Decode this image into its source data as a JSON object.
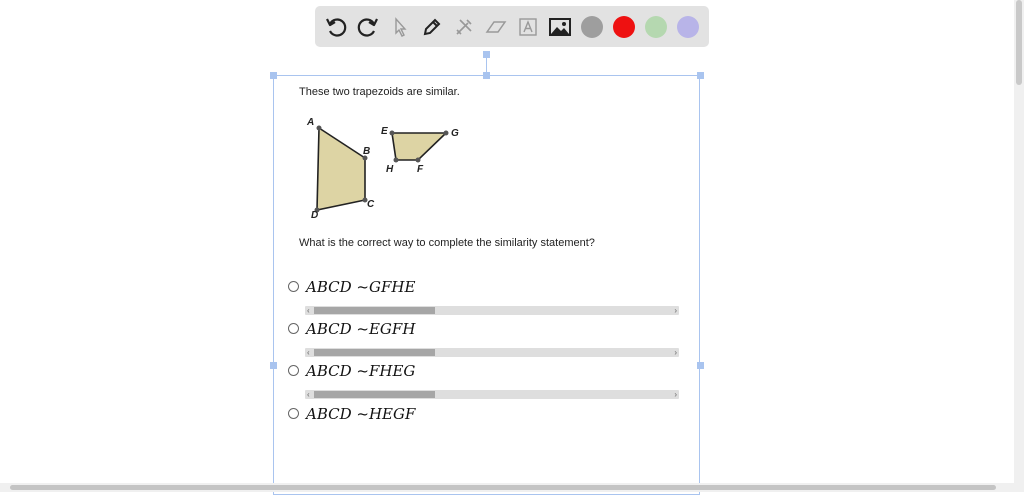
{
  "toolbar": {
    "tools": [
      "undo-icon",
      "redo-icon",
      "pointer-icon",
      "pen-icon",
      "tools-icon",
      "eraser-icon",
      "text-box-icon",
      "image-icon"
    ],
    "colors": [
      "#9e9e9e",
      "#ee1111",
      "#b5d8b0",
      "#b8b4e8"
    ]
  },
  "question": {
    "intro": "These two trapezoids are similar.",
    "prompt": "What is the correct way to complete the similarity statement?"
  },
  "figure": {
    "labels": {
      "A": "A",
      "B": "B",
      "C": "C",
      "D": "D",
      "E": "E",
      "G": "G",
      "H": "H",
      "F": "F"
    },
    "fill_color": "#ddd4a4"
  },
  "options": [
    {
      "text": "ABCD ~GFHE"
    },
    {
      "text": "ABCD ~EGFH"
    },
    {
      "text": "ABCD ~FHEG"
    },
    {
      "text": "ABCD ~HEGF"
    }
  ]
}
